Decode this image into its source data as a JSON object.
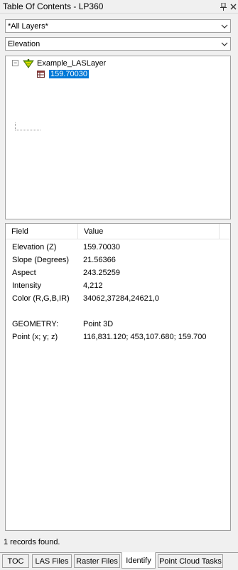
{
  "window": {
    "title": "Table Of Contents - LP360",
    "pin_icon": "pin-icon",
    "close_icon": "close-icon"
  },
  "layer_select": {
    "value": "*All Layers*"
  },
  "attribute_select": {
    "value": "Elevation"
  },
  "tree": {
    "root": {
      "label": "Example_LASLayer",
      "expander": "⊟",
      "icon": "las-layer-icon"
    },
    "child": {
      "label": "159.70030",
      "icon": "table-icon"
    }
  },
  "grid": {
    "headers": {
      "field": "Field",
      "value": "Value"
    },
    "rows": [
      {
        "field": "Elevation (Z)",
        "value": "159.70030"
      },
      {
        "field": "Slope (Degrees)",
        "value": "21.56366"
      },
      {
        "field": "Aspect",
        "value": "243.25259"
      },
      {
        "field": "Intensity",
        "value": "4,212"
      },
      {
        "field": "Color (R,G,B,IR)",
        "value": "34062,37284,24621,0"
      },
      {
        "field": "",
        "value": ""
      },
      {
        "field": "GEOMETRY:",
        "value": "Point 3D"
      },
      {
        "field": "Point (x; y; z)",
        "value": "116,831.120;  453,107.680;  159.700"
      }
    ]
  },
  "status": {
    "text": "1 records found."
  },
  "tabs": [
    {
      "label": "TOC"
    },
    {
      "label": "LAS Files"
    },
    {
      "label": "Raster Files"
    },
    {
      "label": "Identify"
    },
    {
      "label": "Point Cloud Tasks"
    }
  ],
  "active_tab": "Identify",
  "colors": {
    "selection": "#0078d7",
    "layer_icon_green": "#7ab800"
  }
}
